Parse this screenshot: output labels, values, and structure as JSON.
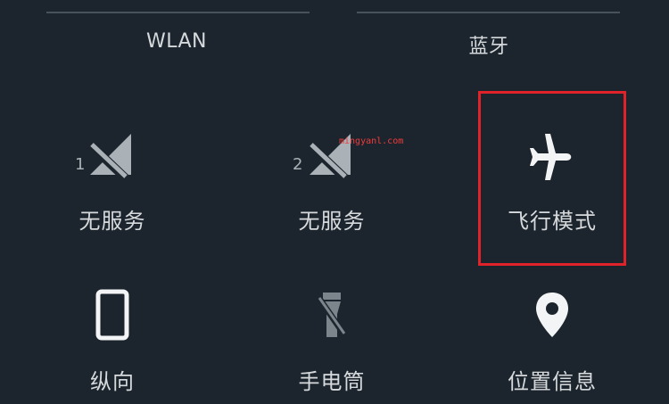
{
  "top": {
    "wlan_label": "WLAN",
    "bluetooth_label": "蓝牙"
  },
  "tiles": [
    {
      "label": "无服务",
      "icon": "no-signal-icon",
      "slot": "1"
    },
    {
      "label": "无服务",
      "icon": "no-signal-icon",
      "slot": "2"
    },
    {
      "label": "飞行模式",
      "icon": "airplane-icon"
    },
    {
      "label": "纵向",
      "icon": "portrait-phone-icon"
    },
    {
      "label": "手电筒",
      "icon": "flashlight-off-icon"
    },
    {
      "label": "位置信息",
      "icon": "location-pin-icon"
    }
  ],
  "watermark": "mingyanl.com",
  "colors": {
    "background": "#1c252d",
    "text": "#d7dadd",
    "highlight": "#e0232a"
  }
}
